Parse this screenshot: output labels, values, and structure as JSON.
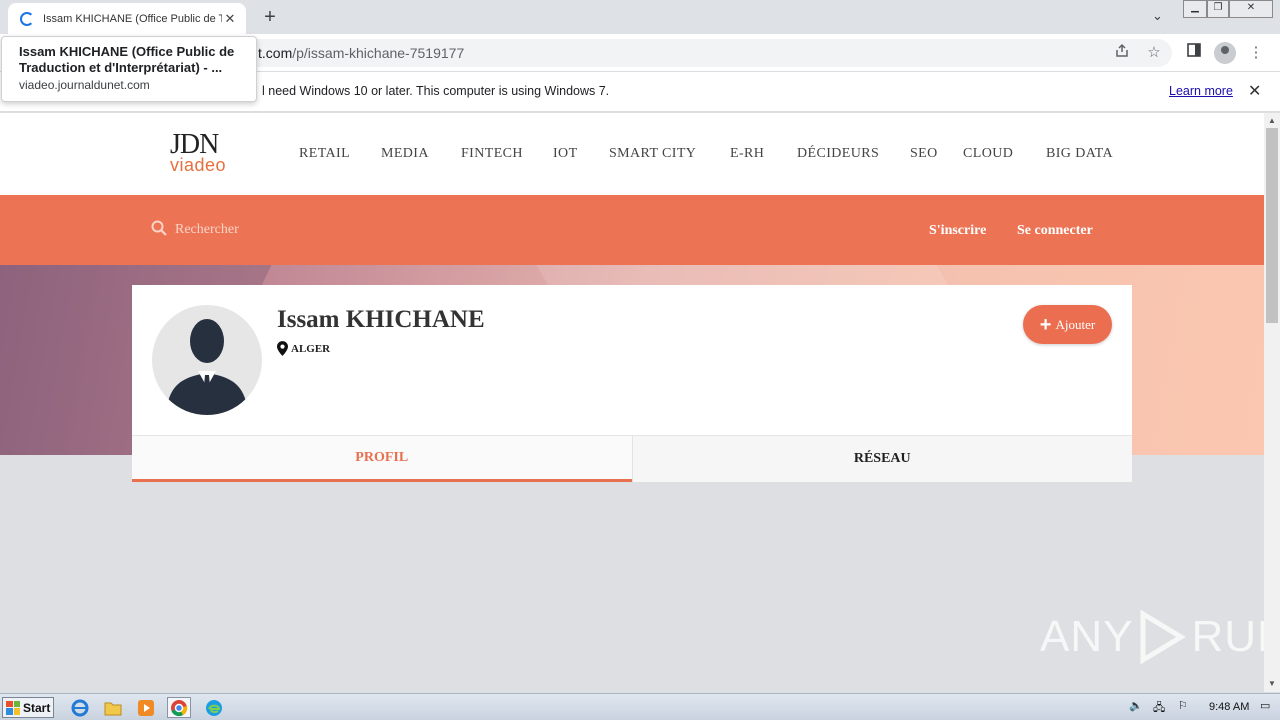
{
  "browser": {
    "tab_title": "Issam KHICHANE (Office Public de Tr",
    "tab_close": "✕",
    "new_tab": "+",
    "url_host": "t.com",
    "url_path": "/p/issam-khichane-7519177",
    "hovercard_title": "Issam KHICHANE (Office Public de Traduction et d'Interprétariat) - ...",
    "hovercard_url": "viadeo.journaldunet.com",
    "infobar_message": "l need Windows 10 or later. This computer is using Windows 7.",
    "infobar_link": "Learn more",
    "infobar_close": "✕"
  },
  "site": {
    "logo_top": "JDN",
    "logo_bottom": "viadeo",
    "nav": [
      "RETAIL",
      "MEDIA",
      "FINTECH",
      "IOT",
      "SMART CITY",
      "E-RH",
      "DÉCIDEURS",
      "SEO",
      "CLOUD",
      "BIG DATA"
    ],
    "search_placeholder": "Rechercher",
    "signup": "S'inscrire",
    "login": "Se connecter"
  },
  "profile": {
    "name": "Issam KHICHANE",
    "location": "ALGER",
    "add_button": "Ajouter",
    "tabs": [
      "PROFIL",
      "RÉSEAU"
    ]
  },
  "watermark": {
    "left": "ANY",
    "right": "RUN"
  },
  "taskbar": {
    "start": "Start",
    "clock": "9:48 AM"
  },
  "colors": {
    "accent": "#ec7455",
    "link": "#1a0dab"
  }
}
